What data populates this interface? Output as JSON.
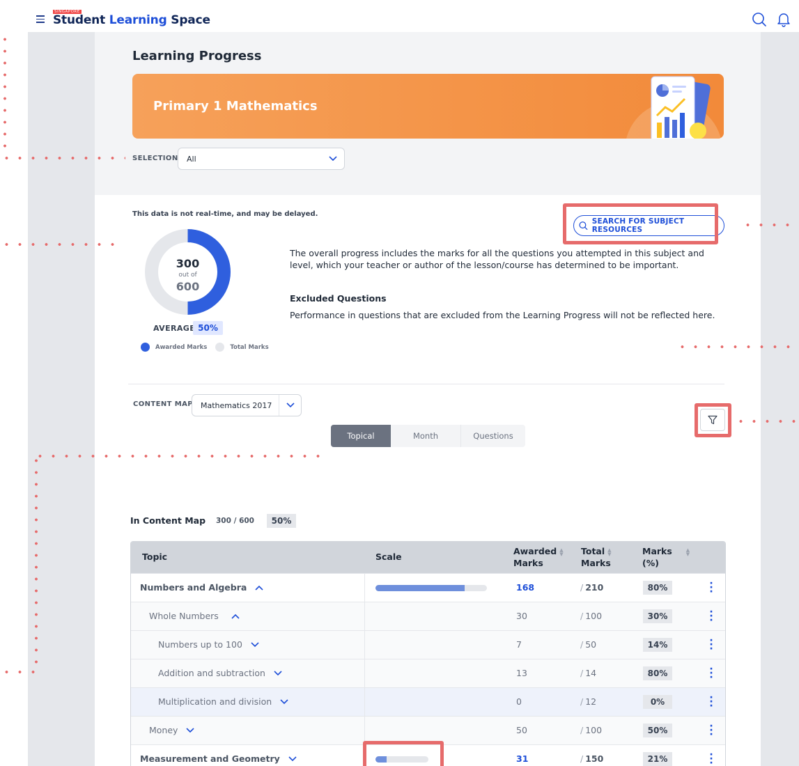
{
  "app": {
    "brand_small": "SINGAPORE",
    "brand_part1": "Student",
    "brand_part2": "Learning",
    "brand_part3": "Space"
  },
  "page": {
    "title": "Learning Progress",
    "banner_title": "Primary 1 Mathematics"
  },
  "selection": {
    "label": "SELECTION",
    "value": "All"
  },
  "progress": {
    "delay_note": "This data is not real-time, and may be delayed.",
    "awarded": "300",
    "out_of": "out of",
    "total": "600",
    "awarded_fraction": 0.5,
    "average_label": "AVERAGE",
    "average_value": "50%",
    "legend_awarded": "Awarded Marks",
    "legend_total": "Total Marks",
    "search_button": "SEARCH FOR SUBJECT RESOURCES",
    "description": "The overall progress includes the marks for all the questions you attempted in this subject and level, which your teacher or author of the lesson/course has determined to be important.",
    "excluded_title": "Excluded Questions",
    "excluded_text": "Performance in questions that are excluded from the Learning Progress will not be reflected here."
  },
  "content_map": {
    "label": "CONTENT MAP",
    "value": "Mathematics 2017",
    "tabs": [
      "Topical",
      "Month",
      "Questions"
    ],
    "active_tab": "Topical"
  },
  "summary": {
    "title": "In Content Map",
    "ratio": "300 / 600",
    "percent": "50%"
  },
  "table": {
    "headers": {
      "topic": "Topic",
      "scale": "Scale",
      "awarded_1": "Awarded",
      "awarded_2": "Marks",
      "total_1": "Total",
      "total_2": "Marks",
      "marks_1": "Marks",
      "marks_2": "(%)"
    },
    "rows": [
      {
        "topic": "Numbers and Algebra",
        "awarded": "168",
        "total": "210",
        "pct": "80%",
        "scale": 0.8
      },
      {
        "topic": "Whole Numbers",
        "awarded": "30",
        "total": "100",
        "pct": "30%"
      },
      {
        "topic": "Numbers up to 100",
        "awarded": "7",
        "total": "50",
        "pct": "14%"
      },
      {
        "topic": "Addition and subtraction",
        "awarded": "13",
        "total": "14",
        "pct": "80%"
      },
      {
        "topic": "Multiplication and division",
        "awarded": "0",
        "total": "12",
        "pct": "0%"
      },
      {
        "topic": "Money",
        "awarded": "50",
        "total": "100",
        "pct": "50%"
      },
      {
        "topic": "Measurement and Geometry",
        "awarded": "31",
        "total": "150",
        "pct": "21%",
        "scale": 0.21
      }
    ]
  },
  "colors": {
    "accent": "#1d4ed8",
    "banner": "#f28a3a",
    "highlight": "#e66b6b",
    "donut_awarded": "#2f5fde",
    "donut_track": "#e5e7eb"
  }
}
